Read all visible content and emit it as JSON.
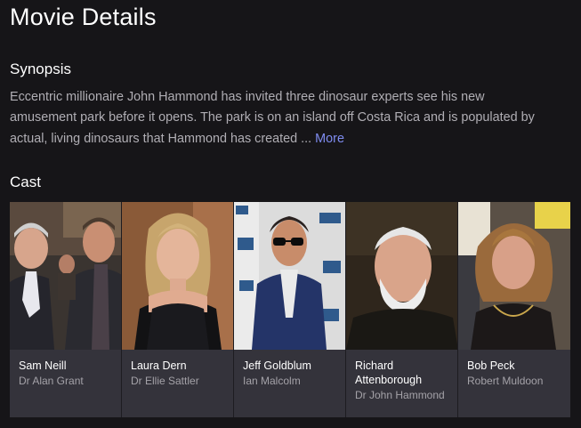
{
  "page": {
    "title": "Movie Details"
  },
  "synopsis": {
    "heading": "Synopsis",
    "lines": [
      "Eccentric millionaire John Hammond has invited three dinosaur experts see his new",
      "amusement park before it opens. The park is on an island off Costa Rica and is populated by",
      "actual, living dinosaurs that Hammond has created ..."
    ],
    "more_label": "More"
  },
  "cast": {
    "heading": "Cast",
    "members": [
      {
        "name": "Sam Neill",
        "role": "Dr Alan Grant"
      },
      {
        "name": "Laura Dern",
        "role": "Dr Ellie Sattler"
      },
      {
        "name": "Jeff Goldblum",
        "role": "Ian Malcolm"
      },
      {
        "name": "Richard Attenborough",
        "role": "Dr John Hammond"
      },
      {
        "name": "Bob Peck",
        "role": "Robert Muldoon"
      }
    ]
  },
  "colors": {
    "background": "#161518",
    "card": "#34333b",
    "body_text": "#b0aeb4",
    "link": "#7f8cf0"
  }
}
